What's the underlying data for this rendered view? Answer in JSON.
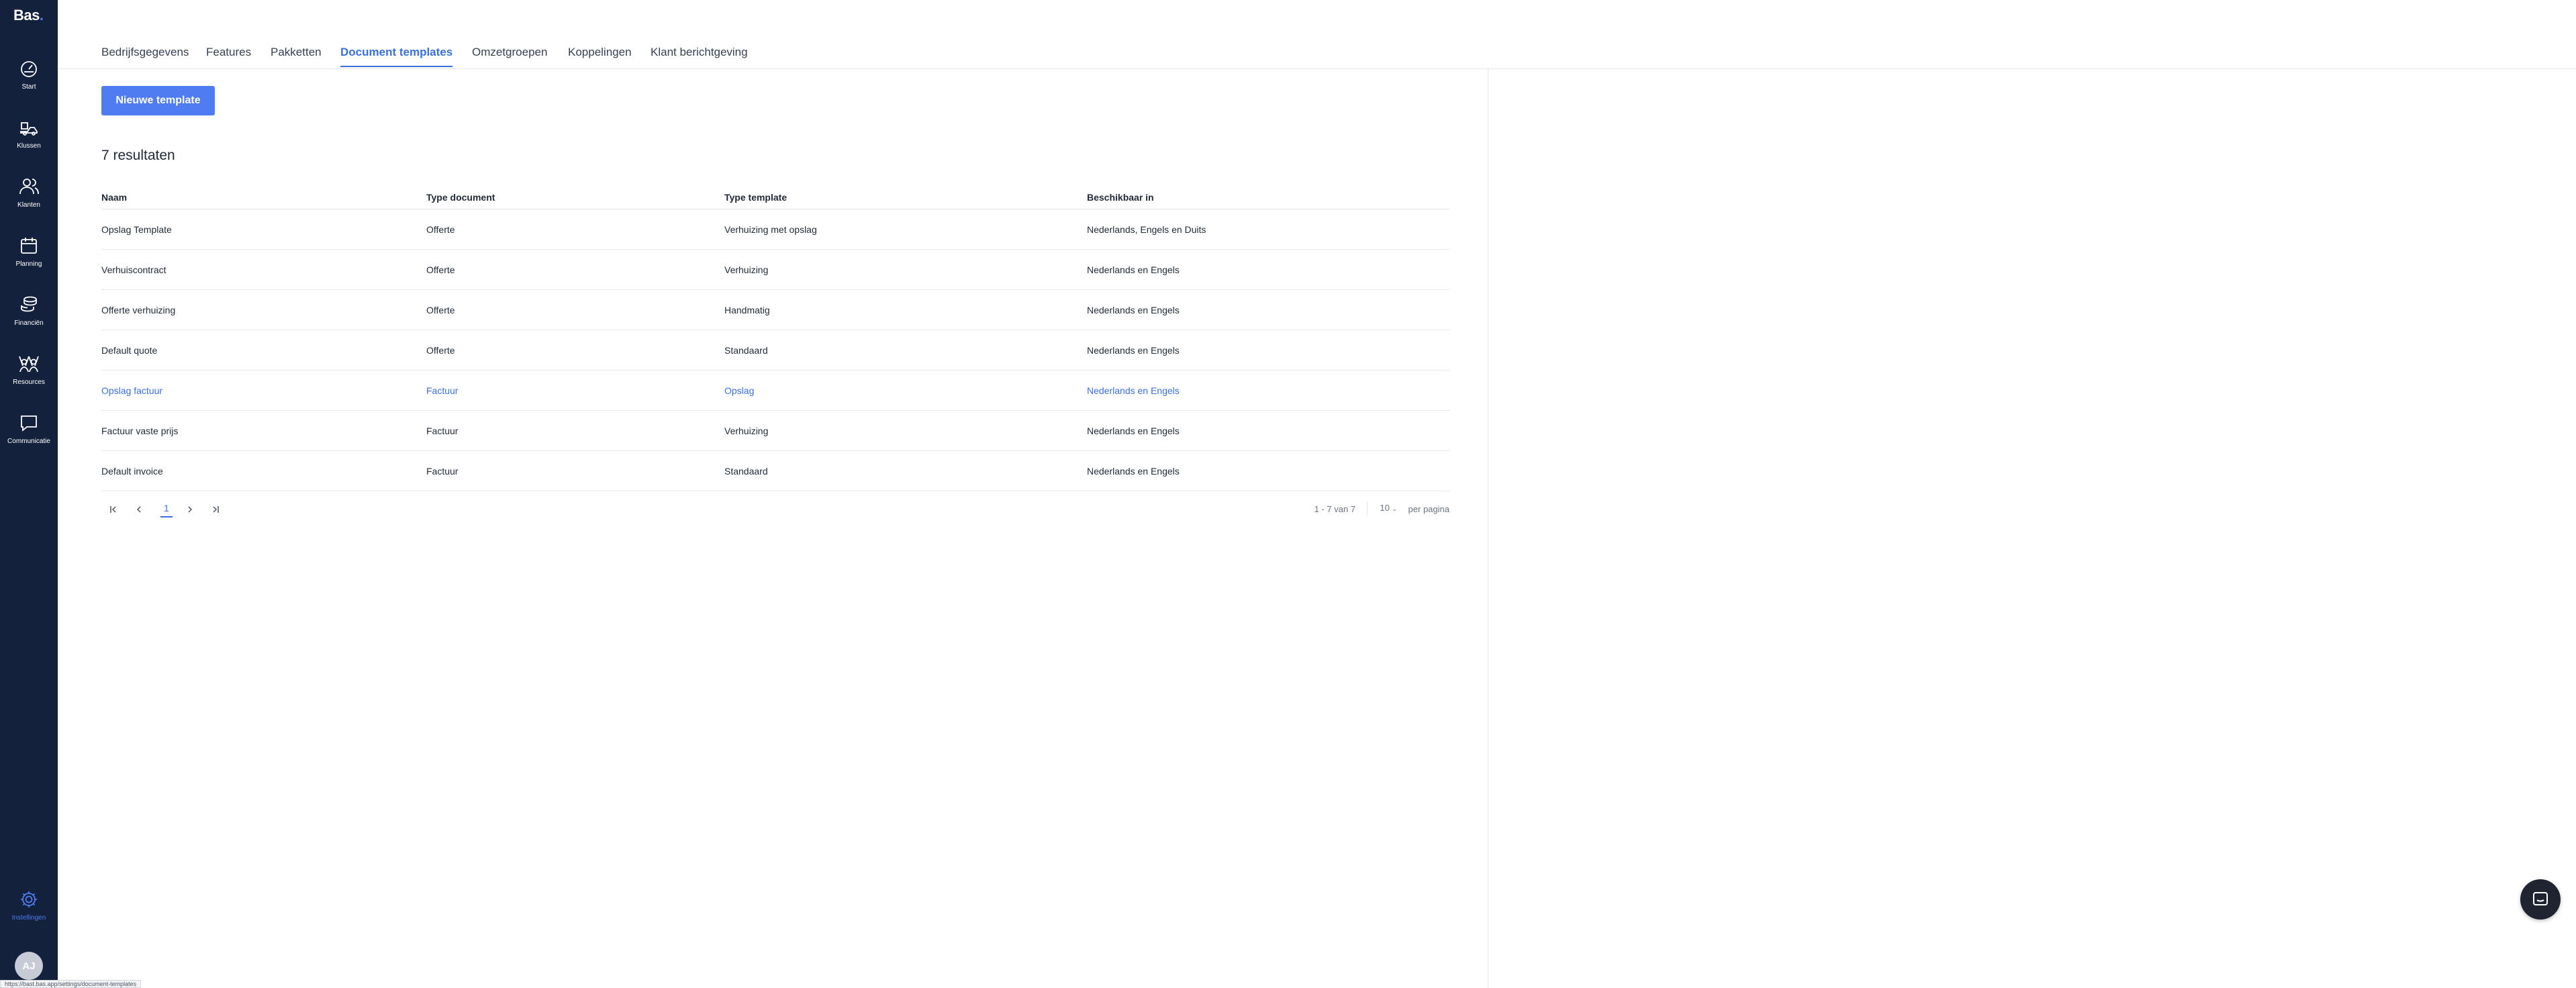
{
  "app": {
    "logo": "Bas",
    "logo_dot": "."
  },
  "sidebar": {
    "items": [
      {
        "label": "Start",
        "icon": "gauge-icon"
      },
      {
        "label": "Klussen",
        "icon": "moving-truck-icon"
      },
      {
        "label": "Klanten",
        "icon": "users-icon"
      },
      {
        "label": "Planning",
        "icon": "calendar-icon"
      },
      {
        "label": "Financiën",
        "icon": "coins-icon"
      },
      {
        "label": "Resources",
        "icon": "people-arms-up-icon"
      },
      {
        "label": "Communicatie",
        "icon": "chat-bubble-icon"
      }
    ],
    "settings": {
      "label": "Instellingen",
      "icon": "gear-icon"
    },
    "avatar": "AJ"
  },
  "tabs": [
    {
      "label": "Bedrijfsgegevens"
    },
    {
      "label": "Features"
    },
    {
      "label": "Pakketten"
    },
    {
      "label": "Document templates",
      "active": true
    },
    {
      "label": "Omzetgroepen"
    },
    {
      "label": "Koppelingen"
    },
    {
      "label": "Klant berichtgeving"
    }
  ],
  "main": {
    "new_button": "Nieuwe template",
    "result_count": "7 resultaten"
  },
  "table": {
    "columns": [
      "Naam",
      "Type document",
      "Type template",
      "Beschikbaar in"
    ],
    "rows": [
      [
        "Opslag Template",
        "Offerte",
        "Verhuizing met opslag",
        "Nederlands, Engels en Duits"
      ],
      [
        "Verhuiscontract",
        "Offerte",
        "Verhuizing",
        "Nederlands en Engels"
      ],
      [
        "Offerte verhuizing",
        "Offerte",
        "Handmatig",
        "Nederlands en Engels"
      ],
      [
        "Default quote",
        "Offerte",
        "Standaard",
        "Nederlands en Engels"
      ],
      [
        "Opslag factuur",
        "Factuur",
        "Opslag",
        "Nederlands en Engels"
      ],
      [
        "Factuur vaste prijs",
        "Factuur",
        "Verhuizing",
        "Nederlands en Engels"
      ],
      [
        "Default invoice",
        "Factuur",
        "Standaard",
        "Nederlands en Engels"
      ]
    ],
    "highlighted_row": 4
  },
  "pagination": {
    "page": "1",
    "range": "1 - 7 van 7",
    "per_page_value": "10",
    "per_page_label": "per pagina"
  },
  "status_url": "https://bast.bas.app/settings/document-templates",
  "colors": {
    "sidebar_bg": "#14213d",
    "accent": "#4f7cf0",
    "link": "#3b6fd9"
  }
}
